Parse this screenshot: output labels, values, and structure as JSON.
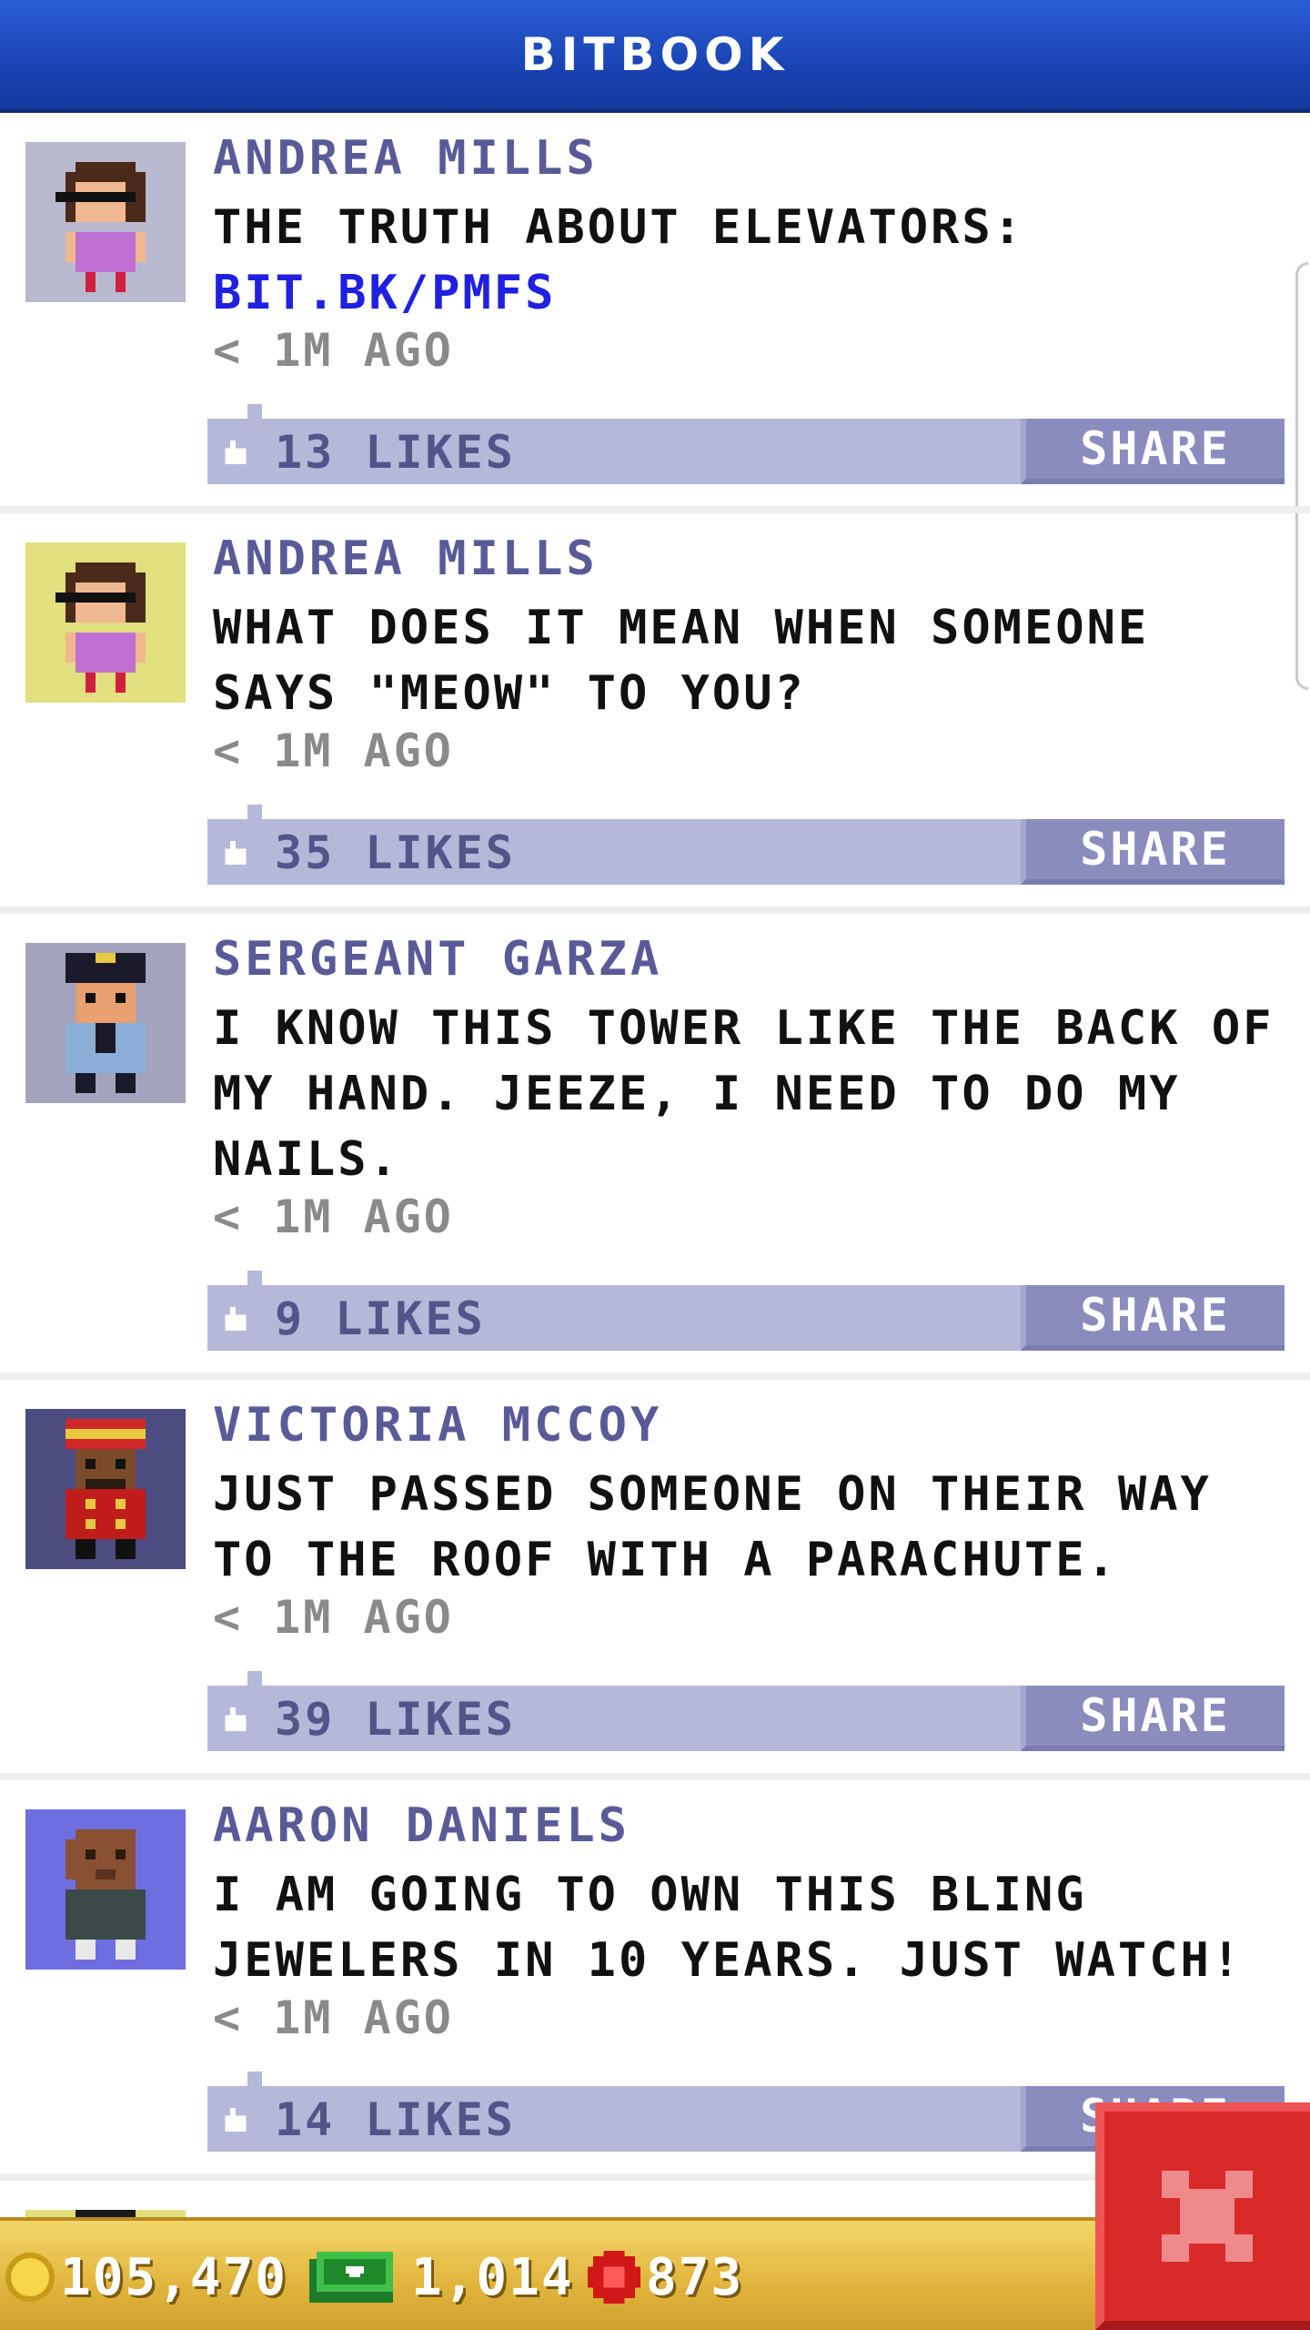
{
  "header": {
    "title": "BITBOOK"
  },
  "posts": [
    {
      "author": "ANDREA MILLS",
      "text": "THE TRUTH ABOUT ELEVATORS:",
      "link": "BIT.BK/PMFS",
      "time": "< 1M AGO",
      "likes": "13 LIKES",
      "share": "SHARE"
    },
    {
      "author": "ANDREA MILLS",
      "text": "WHAT DOES IT MEAN WHEN SOMEONE SAYS \"MEOW\" TO YOU?",
      "time": "< 1M AGO",
      "likes": "35 LIKES",
      "share": "SHARE"
    },
    {
      "author": "SERGEANT GARZA",
      "text": "I KNOW THIS TOWER LIKE THE BACK OF MY HAND. JEEZE, I NEED TO DO MY NAILS.",
      "time": "< 1M AGO",
      "likes": "9 LIKES",
      "share": "SHARE"
    },
    {
      "author": "VICTORIA MCCOY",
      "text": "JUST PASSED SOMEONE ON THEIR WAY TO THE ROOF WITH A PARACHUTE.",
      "time": "< 1M AGO",
      "likes": "39 LIKES",
      "share": "SHARE"
    },
    {
      "author": "AARON DANIELS",
      "text": "I AM GOING TO OWN THIS BLING JEWELERS IN 10 YEARS. JUST WATCH!",
      "time": "< 1M AGO",
      "likes": "14 LIKES",
      "share": "SHARE"
    }
  ],
  "footer": {
    "coins": "105,470",
    "bux": "1,014",
    "gems": "873"
  },
  "icons": {
    "like": "thumbs-up-icon",
    "coin": "coin-icon",
    "bux": "cash-icon",
    "gem": "gem-icon",
    "close": "close-icon"
  },
  "colors": {
    "header": "#1a44b4",
    "author": "#5a5a98",
    "link": "#2020e0",
    "likebar": "#b6b8d9",
    "share": "#8a8cbe",
    "footer": "#e0b43c",
    "close": "#d92a2a"
  }
}
